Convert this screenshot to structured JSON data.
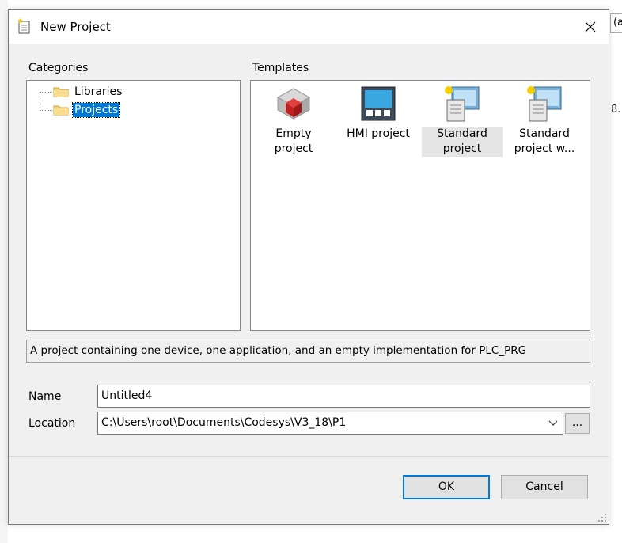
{
  "background": {
    "tab_fragment": "(a",
    "side_fragment": "8."
  },
  "dialog": {
    "title": "New Project",
    "close_icon": "close-icon"
  },
  "categories": {
    "label": "Categories",
    "items": [
      {
        "label": "Libraries",
        "icon": "folder-icon",
        "selected": false
      },
      {
        "label": "Projects",
        "icon": "folder-icon",
        "selected": true
      }
    ]
  },
  "templates": {
    "label": "Templates",
    "items": [
      {
        "label": "Empty project",
        "icon": "empty-project-icon",
        "selected": false
      },
      {
        "label": "HMI project",
        "icon": "hmi-project-icon",
        "selected": false
      },
      {
        "label": "Standard project",
        "icon": "standard-project-icon",
        "selected": true
      },
      {
        "label": "Standard project w...",
        "icon": "standard-project-with-icon",
        "selected": false
      }
    ]
  },
  "description": "A project containing one device, one application, and an empty implementation for PLC_PRG",
  "name_field": {
    "label": "Name",
    "value": "Untitled4"
  },
  "location_field": {
    "label": "Location",
    "value": "C:\\Users\\root\\Documents\\Codesys\\V3_18\\P1",
    "browse_label": "..."
  },
  "buttons": {
    "ok": "OK",
    "cancel": "Cancel"
  },
  "colors": {
    "selection": "#0078d7",
    "dialog_bg": "#f0f0f0",
    "default_button_border": "#0078d7"
  }
}
